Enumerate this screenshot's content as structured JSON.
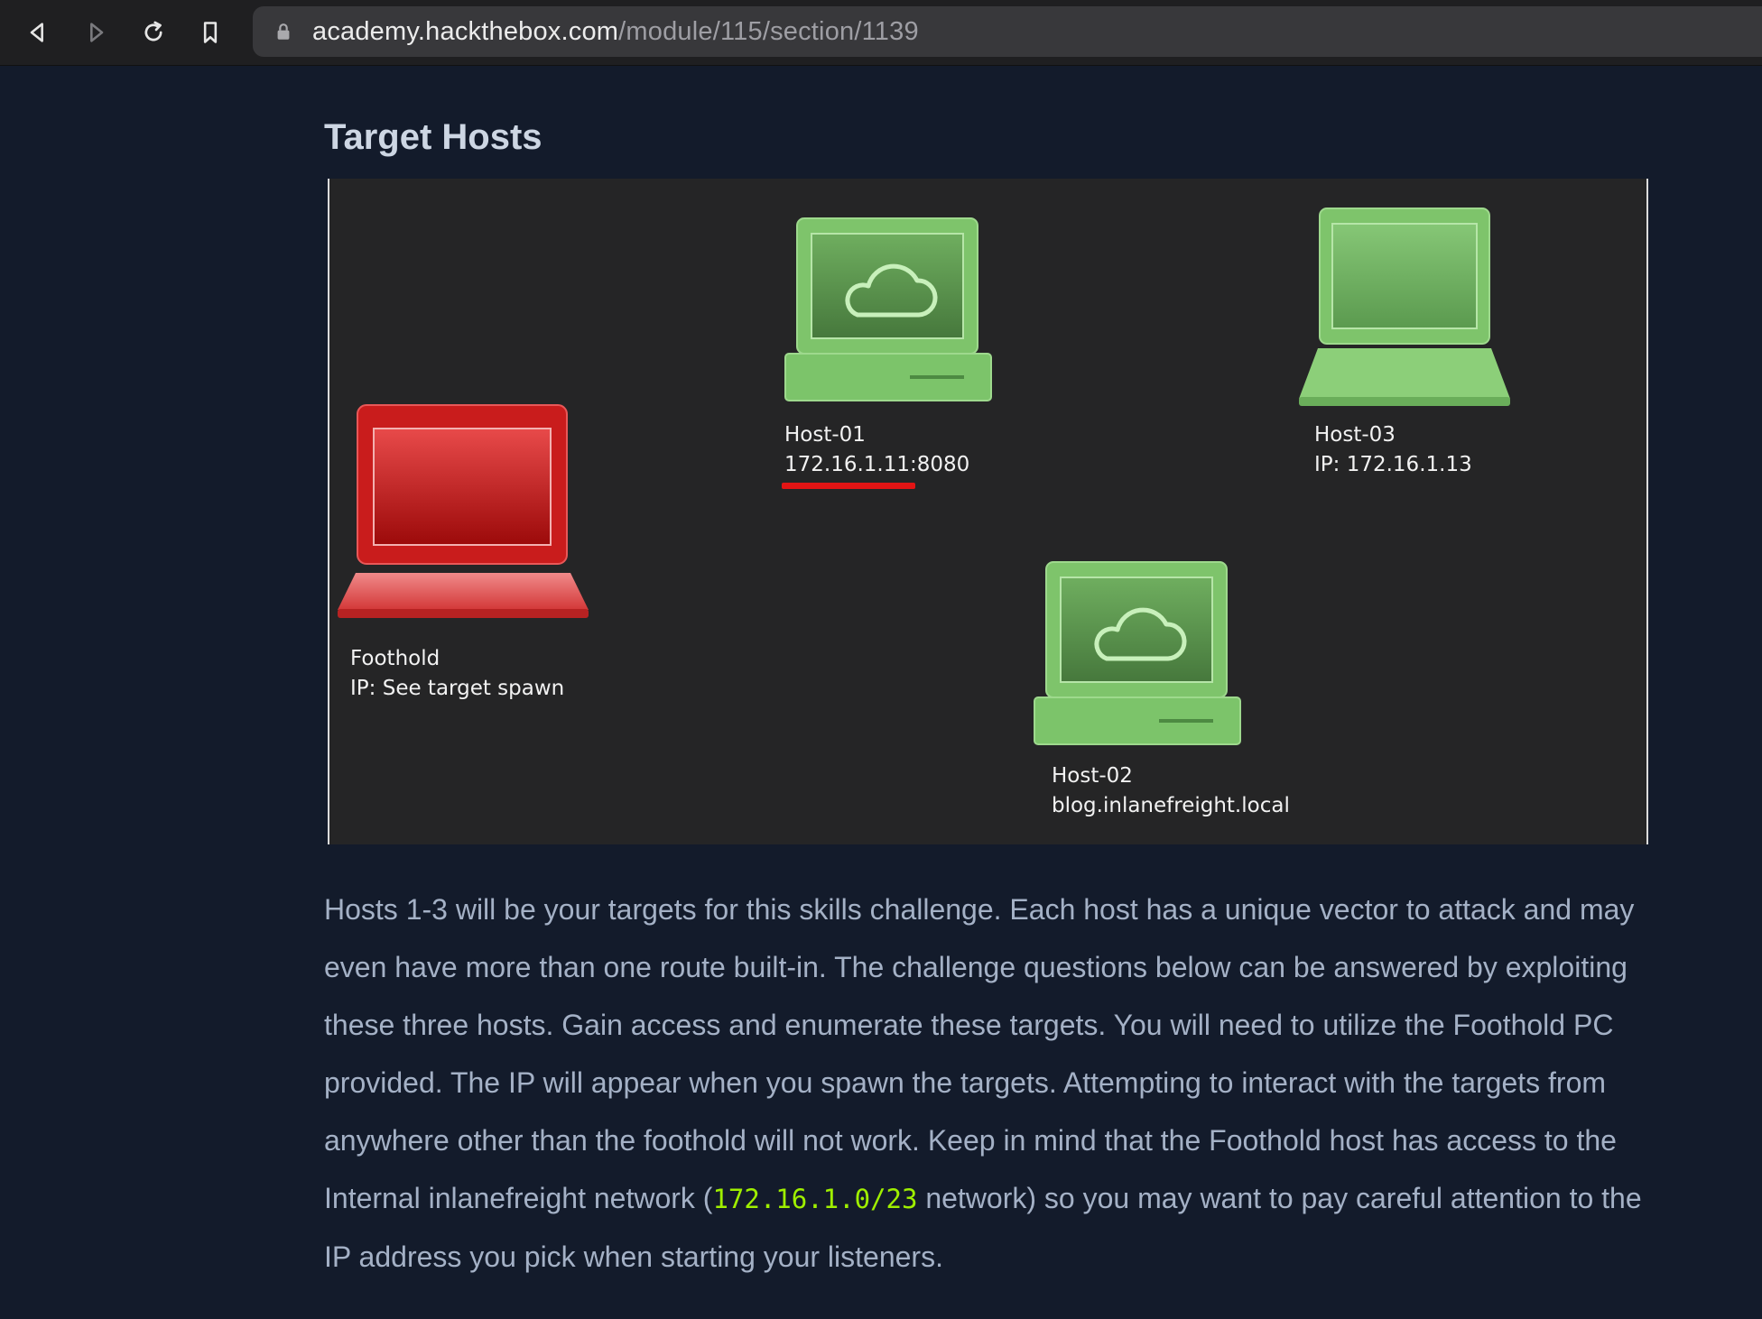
{
  "browser": {
    "url_host": "academy.hackthebox.com",
    "url_path": "/module/115/section/1139"
  },
  "page": {
    "heading": "Target Hosts"
  },
  "diagram": {
    "hosts": [
      {
        "id": "foothold",
        "name": "Foothold",
        "detail": "IP: See target spawn",
        "device": "laptop",
        "color": "#d21d1d"
      },
      {
        "id": "host-01",
        "name": "Host-01",
        "detail": "172.16.1.11:8080",
        "device": "cloud-server",
        "color": "#7cc46a",
        "highlighted": true
      },
      {
        "id": "host-02",
        "name": "Host-02",
        "detail": "blog.inlanefreight.local",
        "device": "cloud-server",
        "color": "#7cc46a"
      },
      {
        "id": "host-03",
        "name": "Host-03",
        "detail": "IP: 172.16.1.13",
        "device": "laptop",
        "color": "#7cc46a"
      }
    ]
  },
  "description": {
    "before_code": "Hosts 1-3 will be your targets for this skills challenge. Each host has a unique vector to attack and may even have more than one route built-in. The challenge questions below can be answered by exploiting these three hosts. Gain access and enumerate these targets. You will need to utilize the Foothold PC provided. The IP will appear when you spawn the targets. Attempting to interact with the targets from anywhere other than the foothold will not work. Keep in mind that the Foothold host has access to the Internal inlanefreight network (",
    "code": "172.16.1.0/23",
    "after_code": " network) so you may want to pay careful attention to the IP address you pick when starting your listeners."
  },
  "colors": {
    "page_bg": "#131b2b",
    "heading": "#cdd6e3",
    "text": "#a4b1c6",
    "code": "#9fef00",
    "highlight_underline": "#e21414"
  }
}
